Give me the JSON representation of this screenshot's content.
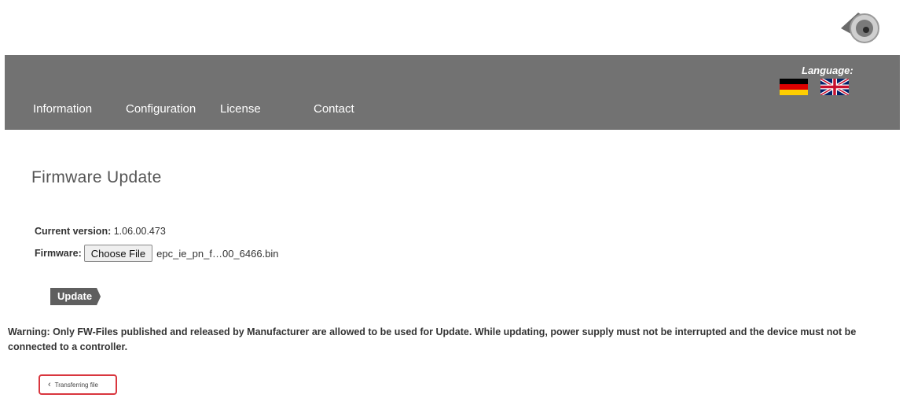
{
  "nav": {
    "items": [
      {
        "label": "Information"
      },
      {
        "label": "Configuration"
      },
      {
        "label": "License"
      },
      {
        "label": "Contact"
      }
    ],
    "language_label": "Language:",
    "flags": [
      {
        "icon": "german-flag-icon"
      },
      {
        "icon": "uk-flag-icon"
      }
    ]
  },
  "page": {
    "title": "Firmware Update",
    "current_version_label": "Current version:",
    "current_version_value": "1.06.00.473",
    "firmware_label": "Firmware:",
    "choose_file_label": "Choose File",
    "file_name": "epc_ie_pn_f…00_6466.bin",
    "update_label": "Update",
    "warning_text": "Warning: Only FW-Files published and released by Manufacturer are allowed to be used for Update. While updating, power supply must not be interrupted and the device must not be connected to a controller.",
    "status_text": "Transferring file",
    "status_icon": "spinner-icon"
  },
  "colors": {
    "navbar": "#727272",
    "button": "#5f5f5f",
    "status_border": "#d9363e"
  }
}
